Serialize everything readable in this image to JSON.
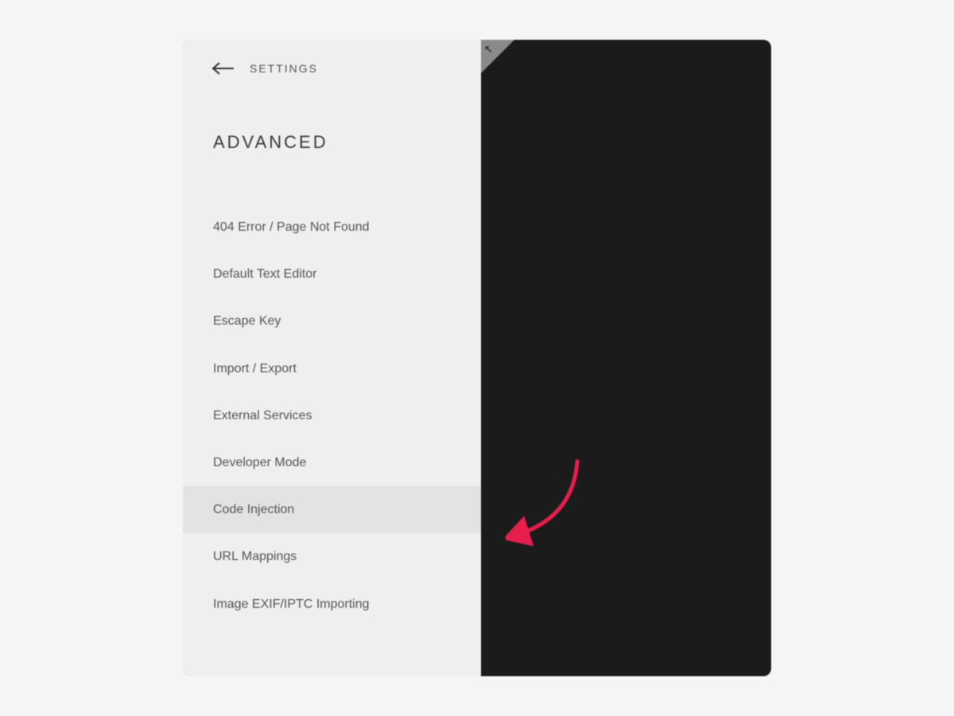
{
  "header": {
    "breadcrumb": "SETTINGS"
  },
  "section": {
    "title": "ADVANCED"
  },
  "menu": {
    "items": [
      {
        "label": "404 Error / Page Not Found",
        "highlighted": false
      },
      {
        "label": "Default Text Editor",
        "highlighted": false
      },
      {
        "label": "Escape Key",
        "highlighted": false
      },
      {
        "label": "Import / Export",
        "highlighted": false
      },
      {
        "label": "External Services",
        "highlighted": false
      },
      {
        "label": "Developer Mode",
        "highlighted": false
      },
      {
        "label": "Code Injection",
        "highlighted": true
      },
      {
        "label": "URL Mappings",
        "highlighted": false
      },
      {
        "label": "Image EXIF/IPTC Importing",
        "highlighted": false
      }
    ]
  },
  "annotation": {
    "arrow_color": "#e61e4d"
  }
}
